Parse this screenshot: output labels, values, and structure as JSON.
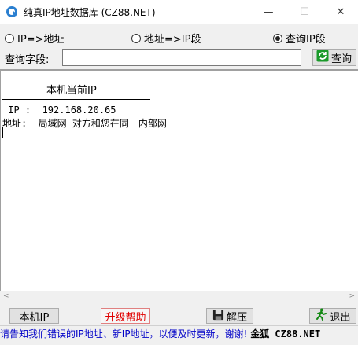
{
  "window": {
    "title": "纯真IP地址数据库 (CZ88.NET)",
    "minimize": "—",
    "maximize": "☐",
    "close": "✕"
  },
  "options": {
    "radio_ip_to_addr": "IP=>地址",
    "radio_addr_to_ip": "地址=>IP段",
    "radio_query_range": "查询IP段",
    "selected": "查询IP段"
  },
  "query": {
    "label": "查询字段:",
    "value": "",
    "button_label": "查询"
  },
  "result": {
    "heading": "本机当前IP",
    "ip_line": " IP :  192.168.20.65",
    "addr_line": "地址:  局域网 对方和您在同一内部网"
  },
  "bottom": {
    "local_ip_button": "本机IP",
    "help_button": "升级帮助",
    "unzip_button": "解压",
    "exit_button": "退出",
    "status_text": "请告知我们错误的IP地址、新IP地址，以便及时更新，谢谢!",
    "brand_text": "金狐 CZ88.NET"
  },
  "colors": {
    "status_blue": "#0000c8",
    "help_red": "#e00000",
    "query_icon_green": "#1a9a2a",
    "exit_icon_green": "#118811"
  },
  "icons": [
    "app-icon",
    "refresh-icon",
    "save-icon",
    "running-man-icon"
  ]
}
